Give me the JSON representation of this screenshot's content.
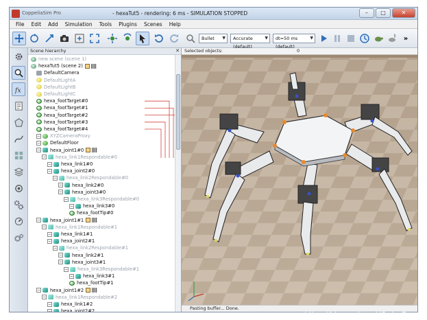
{
  "window": {
    "app_name": "CoppeliaSim Pro",
    "title": "- hexaTut5 - rendering: 6 ms - SIMULATION STOPPED",
    "minimize": "–",
    "maximize": "□",
    "close": "✕"
  },
  "menu": [
    "File",
    "Edit",
    "Add",
    "Simulation",
    "Tools",
    "Plugins",
    "Scenes",
    "Help"
  ],
  "toolbar": {
    "engine": "Bullet",
    "accuracy": "Accurate (default)",
    "dt": "dt=50 ms (default)",
    "more": "»"
  },
  "hierarchy": {
    "title": "Scene hierarchy",
    "close": "✕",
    "rows": [
      {
        "label": "new scene (scene 1)",
        "indent": 0,
        "icon": "scene",
        "dim": true
      },
      {
        "label": "hexaTut5 (scene 2)",
        "indent": 0,
        "icon": "scene",
        "dim": false
      },
      {
        "label": "DefaultCamera",
        "indent": 1,
        "icon": "cam",
        "dim": false
      },
      {
        "label": "DefaultLightA",
        "indent": 1,
        "icon": "light",
        "dim": true
      },
      {
        "label": "DefaultLightB",
        "indent": 1,
        "icon": "light",
        "dim": true
      },
      {
        "label": "DefaultLightC",
        "indent": 1,
        "icon": "light",
        "dim": true
      },
      {
        "label": "hexa_footTarget#0",
        "indent": 1,
        "icon": "dummy",
        "dim": false
      },
      {
        "label": "hexa_footTarget#1",
        "indent": 1,
        "icon": "dummy",
        "dim": false
      },
      {
        "label": "hexa_footTarget#2",
        "indent": 1,
        "icon": "dummy",
        "dim": false
      },
      {
        "label": "hexa_footTarget#3",
        "indent": 1,
        "icon": "dummy",
        "dim": false
      },
      {
        "label": "hexa_footTarget#4",
        "indent": 1,
        "icon": "dummy",
        "dim": false
      },
      {
        "label": "XYZCameraProxy",
        "indent": 1,
        "icon": "obj",
        "dim": true
      },
      {
        "label": "DefaultFloor",
        "indent": 1,
        "icon": "obj",
        "dim": false
      },
      {
        "label": "hexa_joint1#0",
        "indent": 1,
        "icon": "joint",
        "dim": false
      },
      {
        "label": "hexa_link1Respondable#0",
        "indent": 2,
        "icon": "resp",
        "dim": true
      },
      {
        "label": "hexa_link1#0",
        "indent": 3,
        "icon": "joint",
        "dim": false
      },
      {
        "label": "hexa_joint2#0",
        "indent": 3,
        "icon": "joint",
        "dim": false
      },
      {
        "label": "hexa_link2Respondable#0",
        "indent": 4,
        "icon": "resp",
        "dim": true
      },
      {
        "label": "hexa_link2#0",
        "indent": 5,
        "icon": "joint",
        "dim": false
      },
      {
        "label": "hexa_joint3#0",
        "indent": 5,
        "icon": "joint",
        "dim": false
      },
      {
        "label": "hexa_link3Respondable#0",
        "indent": 6,
        "icon": "resp",
        "dim": true
      },
      {
        "label": "hexa_link3#0",
        "indent": 7,
        "icon": "joint",
        "dim": false
      },
      {
        "label": "hexa_footTip#0",
        "indent": 7,
        "icon": "dummy",
        "dim": false
      },
      {
        "label": "hexa_joint1#1",
        "indent": 1,
        "icon": "joint",
        "dim": false
      },
      {
        "label": "hexa_link1Respondable#1",
        "indent": 2,
        "icon": "resp",
        "dim": true
      },
      {
        "label": "hexa_link1#1",
        "indent": 3,
        "icon": "joint",
        "dim": false
      },
      {
        "label": "hexa_joint2#1",
        "indent": 3,
        "icon": "joint",
        "dim": false
      },
      {
        "label": "hexa_link2Respondable#1",
        "indent": 4,
        "icon": "resp",
        "dim": true
      },
      {
        "label": "hexa_link2#1",
        "indent": 5,
        "icon": "joint",
        "dim": false
      },
      {
        "label": "hexa_joint3#1",
        "indent": 5,
        "icon": "joint",
        "dim": false
      },
      {
        "label": "hexa_link3Respondable#1",
        "indent": 6,
        "icon": "resp",
        "dim": true
      },
      {
        "label": "hexa_link3#1",
        "indent": 7,
        "icon": "joint",
        "dim": false
      },
      {
        "label": "hexa_footTip#1",
        "indent": 7,
        "icon": "dummy",
        "dim": false
      },
      {
        "label": "hexa_joint1#2",
        "indent": 1,
        "icon": "joint",
        "dim": false
      },
      {
        "label": "hexa_link1Respondable#2",
        "indent": 2,
        "icon": "resp",
        "dim": true
      },
      {
        "label": "hexa_link1#2",
        "indent": 3,
        "icon": "joint",
        "dim": false
      },
      {
        "label": "hexa_joint2#2",
        "indent": 3,
        "icon": "joint",
        "dim": false
      }
    ]
  },
  "viewport": {
    "selected_label": "Selected objects:",
    "selected_count": "0"
  },
  "status": {
    "message": "Pasting buffer... Done."
  },
  "watermark": "https://blog.csdn.net/Csdn_Daro"
}
